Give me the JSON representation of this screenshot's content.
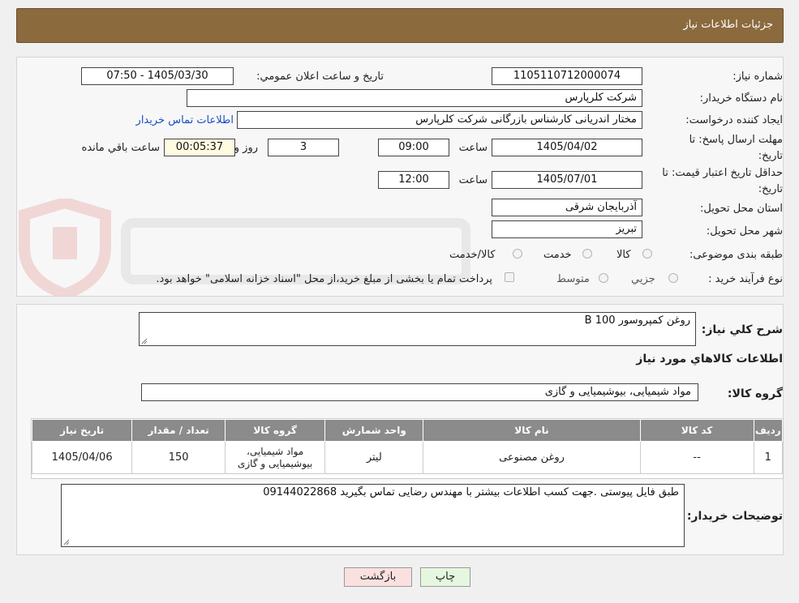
{
  "header": {
    "title": "جزئیات اطلاعات نیاز"
  },
  "form": {
    "need_number_label": "شماره نیاز:",
    "need_number": "1105110712000074",
    "announce_label": "تاریخ و ساعت اعلان عمومي:",
    "announce_value": "1405/03/30 - 07:50",
    "buyer_org_label": "نام دستگاه خريدار:",
    "buyer_org": "شرکت کلرپارس",
    "creator_label": "ايجاد کننده درخواست:",
    "creator": "مختار اندريانی کارشناس بازرگانی شرکت کلرپارس",
    "contact_link": "اطلاعات تماس خريدار",
    "deadline_label": "مهلت ارسال پاسخ: تا تاريخ:",
    "deadline_date": "1405/04/02",
    "time_label": "ساعت",
    "deadline_time": "09:00",
    "days_value": "3",
    "days_label": "روز و",
    "remaining_time": "00:05:37",
    "remaining_label": "ساعت باقي مانده",
    "validity_label": "حداقل تاريخ اعتبار قيمت: تا تاريخ:",
    "validity_date": "1405/07/01",
    "validity_time": "12:00",
    "province_label": "استان محل تحويل:",
    "province": "آذربايجان شرقی",
    "city_label": "شهر محل تحويل:",
    "city": "تبريز",
    "category_label": "طبقه بندی موضوعی:",
    "category_options": [
      "کالا",
      "خدمت",
      "کالا/خدمت"
    ],
    "process_label": "نوع فرآیند خريد :",
    "process_options": [
      "جزيي",
      "متوسط"
    ],
    "payment_note": "پرداخت تمام يا بخشی از مبلغ خريد،از محل \"اسناد خزانه اسلامی\" خواهد بود."
  },
  "details": {
    "description_label": "شرح کلي نياز:",
    "description": "روغن کمپروسور B 100",
    "items_heading": "اطلاعات کالاهاي مورد نياز",
    "group_label": "گروه کالا:",
    "group_value": "مواد شيميايی، بيوشيميايی و  گازی",
    "table": {
      "headers": [
        "رديف",
        "کد کالا",
        "نام کالا",
        "واحد شمارش",
        "گروه کالا",
        "تعداد / مقدار",
        "تاريخ نياز"
      ],
      "rows": [
        [
          "1",
          "--",
          "روغن مصنوعی",
          "ليتر",
          "مواد شيميايی، بيوشيميايی و گازی",
          "150",
          "1405/04/06"
        ]
      ]
    },
    "buyer_notes_label": "توضيحات خريدار:",
    "buyer_notes": "طبق فایل پیوستی .جهت کسب اطلاعات بیشتر با مهندس رضایی تماس بگیرید 09144022868"
  },
  "buttons": {
    "print": "چاپ",
    "back": "بازگشت"
  },
  "colors": {
    "header_bg": "#8b6a3e",
    "link": "#1a4fbf",
    "print_btn": "#e6f7df",
    "back_btn": "#fbe0e0"
  }
}
